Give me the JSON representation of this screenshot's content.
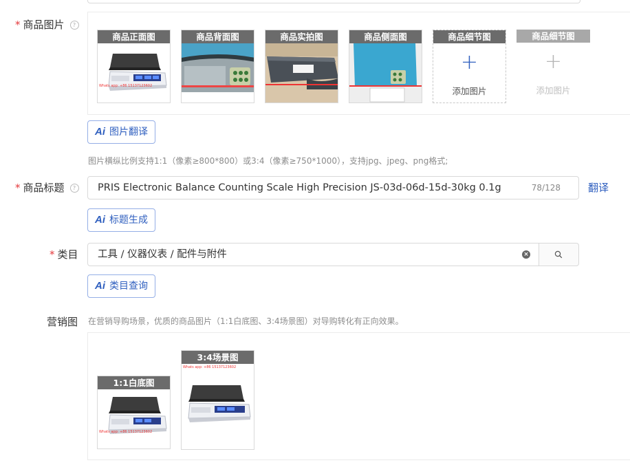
{
  "product_images": {
    "label": "商品图片",
    "help": "?",
    "items": [
      {
        "caption": "商品正面图",
        "watermark": "Whats app: +86 15137123602"
      },
      {
        "caption": "商品背面图"
      },
      {
        "caption": "商品实拍图"
      },
      {
        "caption": "商品侧面图"
      },
      {
        "caption": "商品细节图",
        "add_label": "添加图片",
        "add_icon": "+"
      },
      {
        "caption": "商品细节图",
        "add_label": "添加图片",
        "add_icon": "+"
      }
    ],
    "ai_button": {
      "ai": "Ai",
      "label": "图片翻译"
    },
    "hint": "图片横纵比例支持1:1（像素≥800*800）或3:4（像素≥750*1000），支持jpg、jpeg、png格式;"
  },
  "title": {
    "label": "商品标题",
    "help": "?",
    "value": "PRIS Electronic Balance Counting Scale High Precision JS-03d-06d-15d-30kg 0.1g",
    "counter": "78/128",
    "translate_link": "翻译",
    "ai_button": {
      "ai": "Ai",
      "label": "标题生成"
    }
  },
  "category": {
    "label": "类目",
    "value": "工具 / 仪器仪表 / 配件与附件",
    "ai_button": {
      "ai": "Ai",
      "label": "类目查询"
    }
  },
  "marketing": {
    "label": "营销图",
    "hint": "在营销导购场景，优质的商品图片（1:1白底图、3:4场景图）对导购转化有正向效果。",
    "items": [
      {
        "caption": "1:1白底图",
        "watermark": "Whats app: +86 15137123602"
      },
      {
        "caption": "3:4场景图",
        "watermark": "Whats app: +86 15137123602"
      }
    ]
  },
  "colors": {
    "accent": "#2f5fbf",
    "required": "#e4393c",
    "caption_bg": "#6b6b6b"
  }
}
